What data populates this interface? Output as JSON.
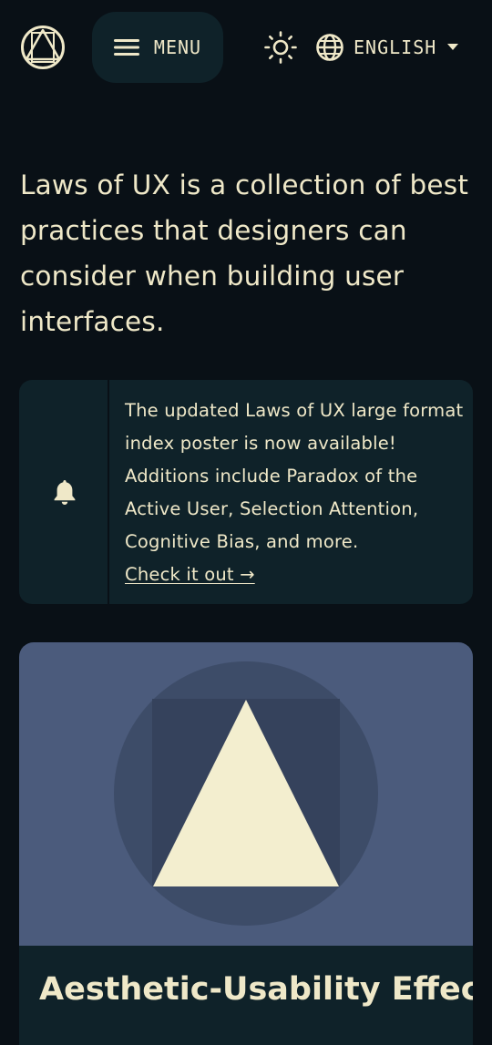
{
  "header": {
    "logo_icon": "laws-of-ux-logo-icon",
    "menu_label": "MENU",
    "menu_icon": "hamburger-icon",
    "theme_icon": "sun-icon",
    "language_icon": "globe-icon",
    "language_label": "ENGLISH",
    "language_caret_icon": "caret-down-icon"
  },
  "intro": {
    "text": "Laws of UX is a collection of best practices that designers can consider when building user interfaces."
  },
  "notice": {
    "icon": "bell-icon",
    "text": "The updated Laws of UX large format index poster is now available! Additions include Paradox of the Active User, Selection Attention, Cognitive Bias, and more.",
    "link_label": "Check it out →"
  },
  "cards": [
    {
      "title": "Aesthetic-Usability Effect",
      "illustration_icon": "triangle-in-circle-illustration"
    }
  ],
  "colors": {
    "background": "#091016",
    "surface": "#0f2229",
    "text": "#efe8c8",
    "card_art_bg": "#4b5b7c",
    "card_circle": "#3d4c68",
    "card_square": "#35425c",
    "card_triangle": "#f3eecf"
  }
}
